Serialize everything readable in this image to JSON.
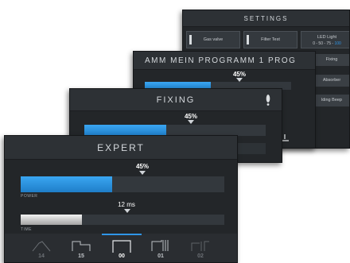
{
  "settings": {
    "title": "SETTINGS",
    "buttons": [
      {
        "label": "Gas valve"
      },
      {
        "label": "Filter Test"
      },
      {
        "label": "LED Light",
        "sub_prefix": "0 - 50 - 75 - ",
        "sub_active": "100"
      }
    ],
    "side_items": [
      "Fixing",
      "Absorber",
      "lding Beep"
    ]
  },
  "program": {
    "title": "AMM   MEIN PROGRAMM 1   PROG",
    "bar_value": "45%",
    "bar_fraction": 0.45
  },
  "fixing": {
    "title": "FIXING",
    "bar_value": "45%",
    "bar_fraction": 0.45
  },
  "expert": {
    "title": "EXPERT",
    "power": {
      "value": "45%",
      "label": "POWER",
      "fraction": 0.45
    },
    "time": {
      "value": "12 ms",
      "label": "TIME",
      "fraction": 0.3
    },
    "programs": [
      {
        "number": "14",
        "active": false,
        "dim": true
      },
      {
        "number": "15",
        "active": false,
        "dim": false
      },
      {
        "number": "00",
        "active": true,
        "dim": false
      },
      {
        "number": "01",
        "active": false,
        "dim": false
      },
      {
        "number": "02",
        "active": false,
        "dim": true
      }
    ]
  },
  "colors": {
    "accent": "#2f96e8",
    "background": "#232629"
  }
}
